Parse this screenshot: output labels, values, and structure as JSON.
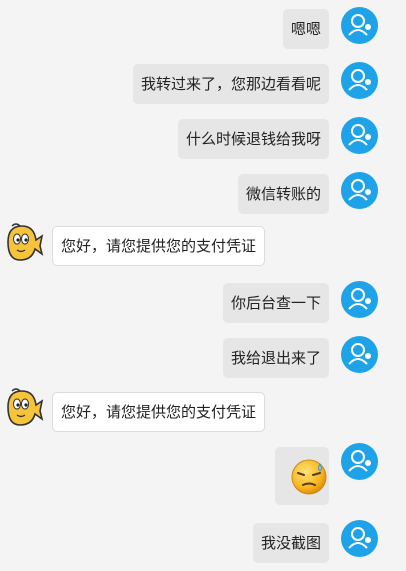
{
  "conversation": {
    "messages": [
      {
        "sender": "user",
        "text": "嗯嗯"
      },
      {
        "sender": "user",
        "text": "我转过来了，您那边看看呢"
      },
      {
        "sender": "user",
        "text": "什么时候退钱给我呀"
      },
      {
        "sender": "user",
        "text": "微信转账的"
      },
      {
        "sender": "bot",
        "text": "您好，请您提供您的支付凭证"
      },
      {
        "sender": "user",
        "text": "你后台查一下"
      },
      {
        "sender": "user",
        "text": "我给退出来了"
      },
      {
        "sender": "bot",
        "text": "您好，请您提供您的支付凭证"
      },
      {
        "sender": "user",
        "emoji": "sweat-emoji"
      },
      {
        "sender": "user",
        "text": "我没截图"
      }
    ]
  },
  "colors": {
    "user_avatar": "#1fa3e8",
    "user_bubble": "#e6e6e6",
    "bot_bubble": "#ffffff",
    "background": "#f4f4f4"
  }
}
